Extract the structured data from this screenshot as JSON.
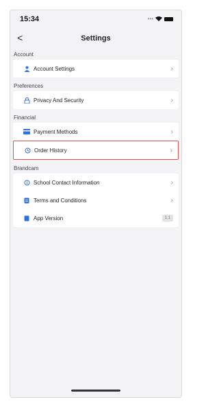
{
  "status": {
    "time": "15:34"
  },
  "nav": {
    "back_symbol": "<",
    "title": "Settings"
  },
  "sections": {
    "account": {
      "header": "Account",
      "items": [
        {
          "label": "Account Settings",
          "icon": "person-icon"
        }
      ]
    },
    "preferences": {
      "header": "Preferences",
      "items": [
        {
          "label": "Privacy And Security",
          "icon": "lock-icon"
        }
      ]
    },
    "financial": {
      "header": "Financial",
      "items": [
        {
          "label": "Payment Methods",
          "icon": "card-icon"
        },
        {
          "label": "Order History",
          "icon": "history-icon"
        }
      ]
    },
    "brandcam": {
      "header": "Brandcam",
      "items": [
        {
          "label": "School Contact Information",
          "icon": "info-icon"
        },
        {
          "label": "Terms and Conditions",
          "icon": "document-icon"
        },
        {
          "label": "App Version",
          "icon": "phone-icon",
          "badge": "1.1"
        }
      ]
    }
  },
  "colors": {
    "accent": "#2f6fe0",
    "highlight": "#d9534f",
    "background": "#f3f3f5"
  }
}
